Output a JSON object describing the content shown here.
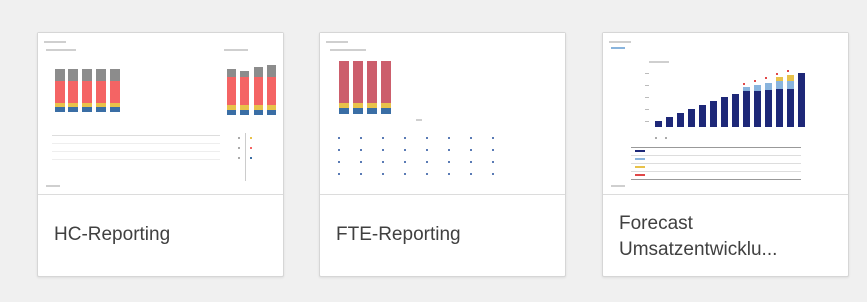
{
  "cards": [
    {
      "title": "HC-Reporting"
    },
    {
      "title": "FTE-Reporting"
    },
    {
      "title_line1": "Forecast",
      "title_line2": "Umsatzentwicklu..."
    }
  ],
  "colors": {
    "background": "#f0f0f0",
    "card_border": "#d6d6d6",
    "title_text": "#404040",
    "bar_gray": "#8c8c8c",
    "bar_red": "#f46464",
    "bar_yellow": "#e8c24a",
    "bar_blue": "#3a6ea5",
    "bar_rose": "#cc5e6c",
    "bar_navy": "#1e2878",
    "bar_lightblue": "#89b4dd"
  }
}
